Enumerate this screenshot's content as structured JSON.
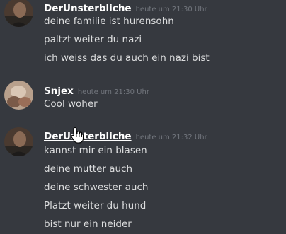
{
  "messages": [
    {
      "author": "DerUnsterbliche",
      "timestamp": "heute um 21:30 Uhr",
      "lines": [
        "deine familie ist hurensohn",
        "paltzt weiter du nazi",
        "ich weiss das du auch ein nazi bist"
      ]
    },
    {
      "author": "Snjex",
      "timestamp": "heute um 21:30 Uhr",
      "lines": [
        "Cool woher"
      ]
    },
    {
      "author": "DerUnsterbliche",
      "timestamp": "heute um 21:32 Uhr",
      "lines": [
        "kannst mir ein blasen",
        "deine mutter auch",
        "deine schwester auch",
        "Platzt weiter du hund",
        "bist nur ein neider"
      ]
    }
  ],
  "colors": {
    "background": "#36393f",
    "username": "#ffffff",
    "timestamp": "#72767d",
    "message_text": "#dcddde"
  },
  "cursor": {
    "icon": "hand-pointer-icon"
  }
}
